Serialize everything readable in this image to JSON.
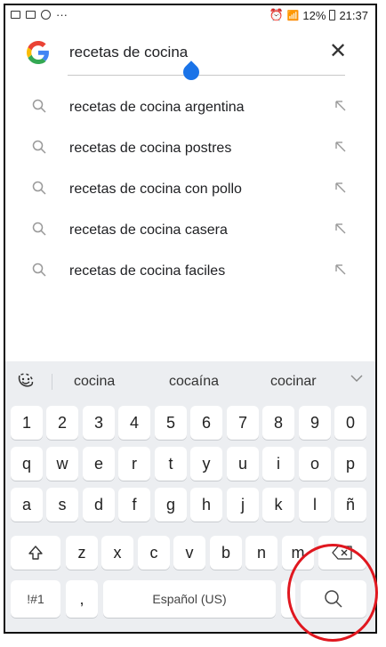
{
  "status_bar": {
    "battery_percent": "12%",
    "time": "21:37",
    "left_more": "···"
  },
  "search": {
    "query": "recetas de cocina",
    "clear_glyph": "✕"
  },
  "suggestions": [
    "recetas de cocina argentina",
    "recetas de cocina postres",
    "recetas de cocina con pollo",
    "recetas de cocina casera",
    "recetas de cocina faciles"
  ],
  "keyboard": {
    "predictions": [
      "cocina",
      "cocaína",
      "cocinar"
    ],
    "row_numbers": [
      "1",
      "2",
      "3",
      "4",
      "5",
      "6",
      "7",
      "8",
      "9",
      "0"
    ],
    "row_top": [
      "q",
      "w",
      "e",
      "r",
      "t",
      "y",
      "u",
      "i",
      "o",
      "p"
    ],
    "row_home": [
      "a",
      "s",
      "d",
      "f",
      "g",
      "h",
      "j",
      "k",
      "l",
      "ñ"
    ],
    "row_bottom": [
      "z",
      "x",
      "c",
      "v",
      "b",
      "n",
      "m"
    ],
    "symbols_label": "!#1",
    "comma_label": ",",
    "space_label": "Español (US)"
  },
  "colors": {
    "accent": "#1a73e8",
    "highlight_ring": "#e0171f",
    "keyboard_bg": "#eceef1"
  }
}
